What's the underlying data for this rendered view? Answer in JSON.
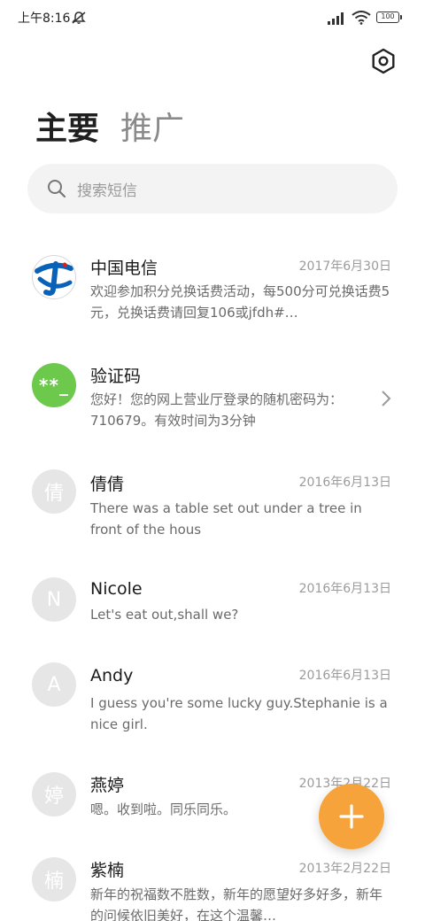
{
  "status_bar": {
    "time": "上午8:16",
    "battery": "100"
  },
  "header": {
    "tabs": [
      {
        "label": "主要"
      },
      {
        "label": "推广"
      }
    ]
  },
  "search": {
    "placeholder": "搜索短信"
  },
  "conversations": [
    {
      "avatar": "",
      "avatar_style": "telecom-logo",
      "name": "中国电信",
      "date": "2017年6月30日",
      "preview": "欢迎参加积分兑换话费活动，每500分可兑换话费5元，兑换话费请回复106或jfdh#…"
    },
    {
      "avatar": "**_",
      "avatar_style": "green",
      "name": "验证码",
      "date": "",
      "preview": "您好！您的网上营业厅登录的随机密码为：710679。有效时间为3分钟"
    },
    {
      "avatar": "倩",
      "avatar_style": "gray",
      "name": "倩倩",
      "date": "2016年6月13日",
      "preview": "There was a table set out under a tree in front of the hous"
    },
    {
      "avatar": "N",
      "avatar_style": "gray",
      "name": "Nicole",
      "date": "2016年6月13日",
      "preview": "Let's eat out,shall we?"
    },
    {
      "avatar": "A",
      "avatar_style": "gray",
      "name": "Andy",
      "date": "2016年6月13日",
      "preview": "I guess you're some lucky guy.Stephanie is a nice girl."
    },
    {
      "avatar": "婷",
      "avatar_style": "gray",
      "name": "燕婷",
      "date": "2013年2月22日",
      "preview": "嗯。收到啦。同乐同乐。"
    },
    {
      "avatar": "楠",
      "avatar_style": "gray",
      "name": "紫楠",
      "date": "2013年2月22日",
      "preview": "新年的祝福数不胜数，新年的愿望好多好多，新年的问候依旧美好，在这个温馨…"
    }
  ],
  "icons": {
    "settings": "settings-hexagon-icon",
    "search": "search-icon",
    "compose": "plus-icon",
    "chevron": "chevron-right-icon"
  },
  "colors": {
    "fab": "#f5a33a",
    "verification_avatar": "#6cc94c",
    "telecom_blue": "#0a62b8",
    "telecom_red": "#d9201b"
  }
}
